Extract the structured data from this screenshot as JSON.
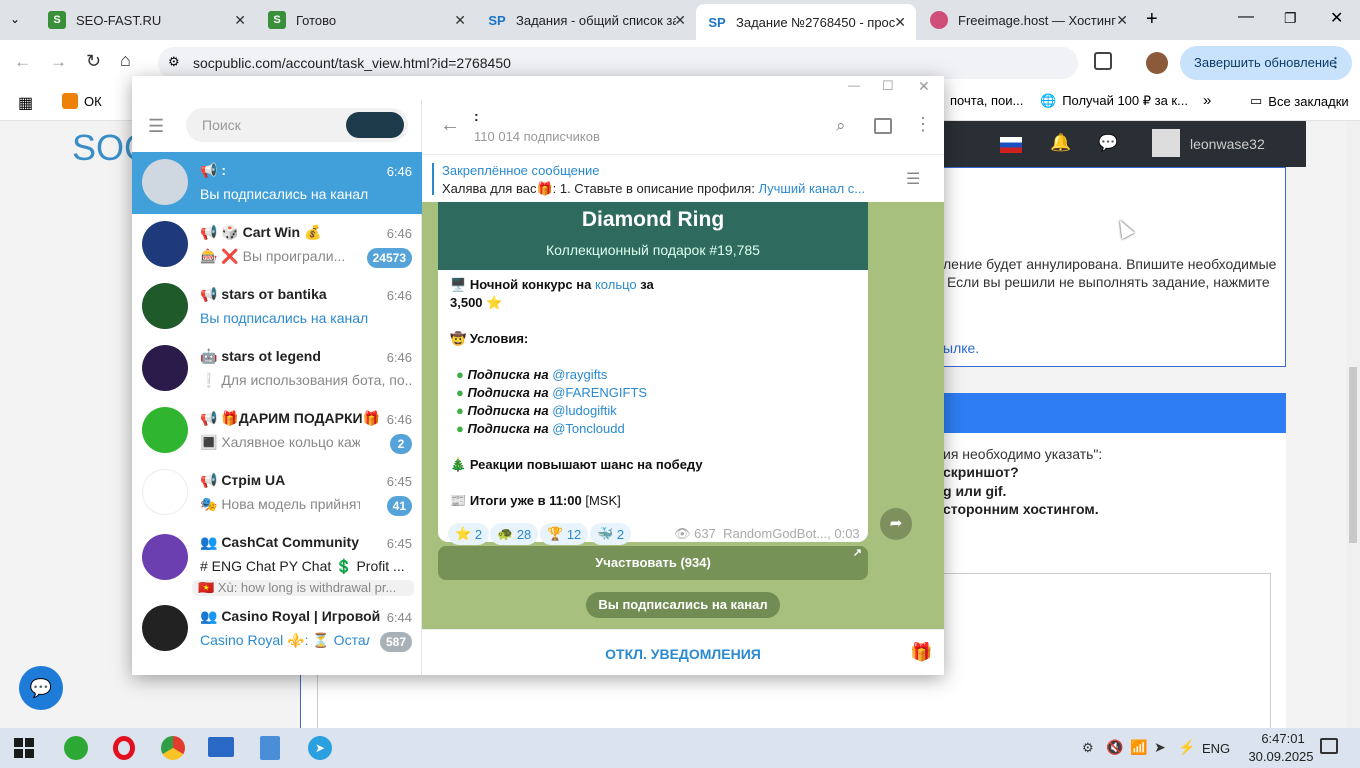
{
  "browser": {
    "tabs": [
      {
        "title": "SEO-FAST.RU",
        "icon": "S"
      },
      {
        "title": "Готово",
        "icon": "S"
      },
      {
        "title": "Задания - общий список за",
        "icon": "SP"
      },
      {
        "title": "Задание №2768450 - прос",
        "icon": "SP"
      },
      {
        "title": "Freeimage.host — Хостинг",
        "icon": "F"
      }
    ],
    "url": "socpublic.com/account/task_view.html?id=2768450",
    "update_label": "Завершить обновление",
    "bookmarks": {
      "ok": "ОК",
      "mail": "почта, пои...",
      "get100": "Получай 100 ₽ за к...",
      "all": "Все закладки"
    }
  },
  "site": {
    "logo": "SOC",
    "username": "leonwase32",
    "text1": "ление будет аннулирована. Впишите необходимые",
    "text2": "Если вы решили не выполнять задание, нажмите",
    "text3": "ылке.",
    "text4": "ия необходимо указать\":",
    "text5": "скриншот?",
    "text6": "g или gif.",
    "text7": "сторонним хостингом."
  },
  "telegram": {
    "search_placeholder": "Поиск",
    "chats": [
      {
        "name": "📢 :",
        "time": "6:46",
        "msg": "Вы подписались на канал",
        "badge": "",
        "avatar_color": "#cfd8e0"
      },
      {
        "name": "📢 🎲 Cart Win 💰",
        "time": "6:46",
        "msg": "🎰 ❌ Вы проиграли... ",
        "badge": "24573",
        "avatar_color": "#1f3a7a"
      },
      {
        "name": "📢 stars от bantika",
        "time": "6:46",
        "msg": "Вы подписались на канал",
        "badge": "",
        "avatar_color": "#1e5a2a"
      },
      {
        "name": "🤖 stars ot legend",
        "time": "6:46",
        "msg": "❕ Для использования бота, по...",
        "badge": "",
        "avatar_color": "#2b1b4a"
      },
      {
        "name": "📢 🎁ДАРИМ ПОДАРКИ🎁",
        "time": "6:46",
        "msg": "🔳 Халявное кольцо каждо...",
        "badge": "2",
        "avatar_color": "#2fb52f"
      },
      {
        "name": "📢 Стрім UA",
        "time": "6:45",
        "msg": "🎭 Нова модель прийнятя...",
        "badge": "41",
        "avatar_color": "#ffffff"
      },
      {
        "name": "👥 CashCat Community",
        "time": "6:45",
        "msg": "# ENG Chat   PY Chat   💲 Profit ...",
        "badge": "",
        "avatar_color": "#6b3fb0"
      },
      {
        "name": "👥 Casino Royal | Игровой...",
        "time": "6:44",
        "msg": "Casino Royal ⚜️: ⏳ Остал...",
        "badge": "587",
        "avatar_color": "#222"
      }
    ],
    "cashcat_sub": "🇻🇳 Xù: how long is withdrawal pr...",
    "header": {
      "title": ":",
      "subtitle": "110 014 подписчиков"
    },
    "pinned": {
      "label": "Закреплённое сообщение",
      "text": "Халява для вас🎁:  1. Ставьте в описание профиля:",
      "link": "Лучший канал с..."
    },
    "post": {
      "title": "Diamond Ring",
      "subtitle": "Коллекционный подарок #19,785",
      "contest": "Ночной конкурс на",
      "contest_link": "кольцо",
      "contest_tail": "за",
      "prize": "3,500 ⭐",
      "conditions": "Условия:",
      "subs_label": "Подписка на",
      "subs": [
        "@raygifts",
        "@FARENGIFTS",
        "@ludogiftik",
        "@Toncloudd"
      ],
      "reactions_note": "Реакции повышают шанс на победу",
      "results": "Итоги уже в 11:00",
      "results_tz": "[MSK]",
      "reactions": [
        {
          "e": "⭐",
          "n": "2"
        },
        {
          "e": "🐢",
          "n": "28"
        },
        {
          "e": "🏆",
          "n": "12"
        },
        {
          "e": "🐳",
          "n": "2"
        }
      ],
      "views": "637",
      "meta": "RandomGodBot..., 0:03",
      "button": "Участвовать (934)",
      "service": "Вы подписались на канал"
    },
    "footer": "ОТКЛ. УВЕДОМЛЕНИЯ"
  },
  "taskbar": {
    "lang": "ENG",
    "time": "6:47:01",
    "date": "30.09.2025"
  }
}
